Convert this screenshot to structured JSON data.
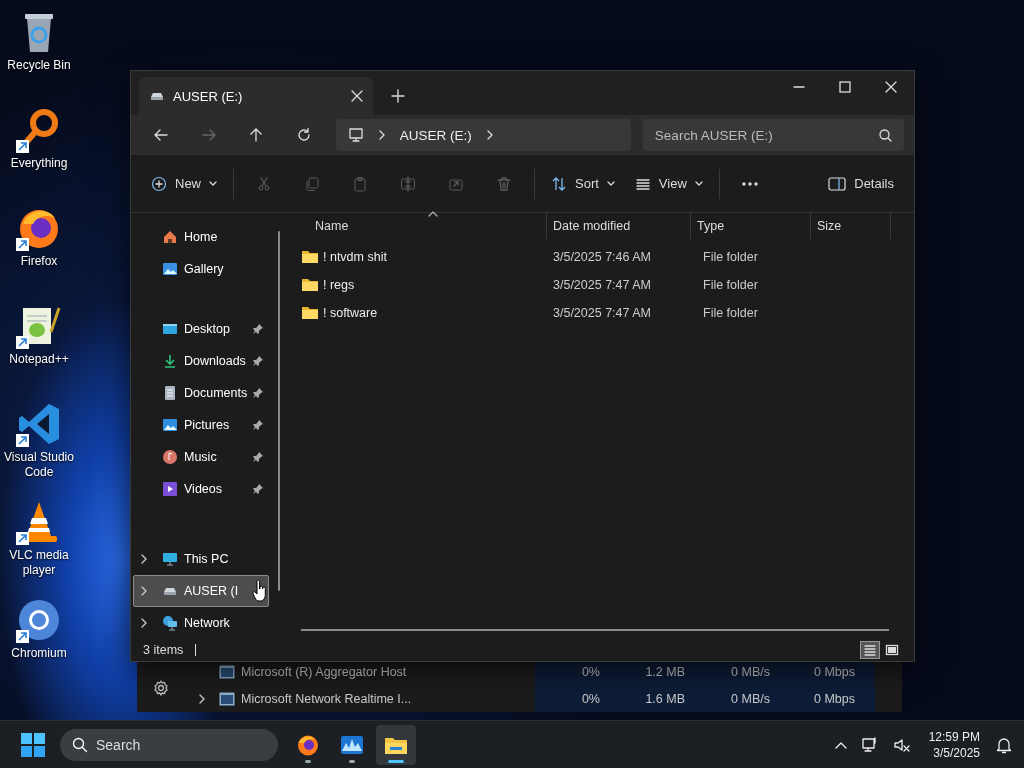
{
  "desktop_icons": [
    {
      "label": "Recycle Bin",
      "kind": "recycle-bin",
      "shortcut": false
    },
    {
      "label": "Everything",
      "kind": "everything",
      "shortcut": true
    },
    {
      "label": "Firefox",
      "kind": "firefox",
      "shortcut": true
    },
    {
      "label": "Notepad++",
      "kind": "notepad",
      "shortcut": true
    },
    {
      "label": "Visual Studio Code",
      "kind": "vscode",
      "shortcut": true
    },
    {
      "label": "VLC media player",
      "kind": "vlc",
      "shortcut": true
    },
    {
      "label": "Chromium",
      "kind": "chromium",
      "shortcut": true
    }
  ],
  "task_manager": {
    "rows": [
      {
        "name": "Microsoft (R) Aggregator Host",
        "expandable": false,
        "values": [
          "0%",
          "1.2 MB",
          "0 MB/s",
          "0 Mbps"
        ]
      },
      {
        "name": "Microsoft Network Realtime I...",
        "expandable": true,
        "values": [
          "0%",
          "1.6 MB",
          "0 MB/s",
          "0 Mbps"
        ]
      }
    ]
  },
  "explorer": {
    "tabs": [
      {
        "title": "AUSER (E:)",
        "selected": true
      }
    ],
    "breadcrumb": [
      "AUSER (E:)"
    ],
    "search": {
      "placeholder": "Search AUSER (E:)"
    },
    "toolbar": {
      "groups": [
        [
          {
            "kind": "new",
            "label": "New",
            "disabled": false
          }
        ],
        [
          {
            "kind": "cut",
            "disabled": true
          },
          {
            "kind": "copy",
            "disabled": true
          },
          {
            "kind": "paste",
            "disabled": true
          },
          {
            "kind": "rename",
            "disabled": true
          },
          {
            "kind": "share",
            "disabled": true
          },
          {
            "kind": "delete",
            "disabled": true
          }
        ],
        [
          {
            "kind": "sort",
            "label": "Sort",
            "disabled": false
          },
          {
            "kind": "view",
            "label": "View",
            "disabled": false
          }
        ],
        [
          {
            "kind": "more",
            "disabled": false
          }
        ]
      ],
      "details": {
        "label": "Details"
      }
    },
    "sidebar": {
      "groups": [
        {
          "items": [
            {
              "label": "Home",
              "kind": "home",
              "pinned": false,
              "expandable": false,
              "selected": false
            },
            {
              "label": "Gallery",
              "kind": "gallery",
              "pinned": false,
              "expandable": false,
              "selected": false
            }
          ]
        },
        {
          "items": [
            {
              "label": "Desktop",
              "kind": "desktop",
              "pinned": true,
              "expandable": false,
              "selected": false
            },
            {
              "label": "Downloads",
              "kind": "downloads",
              "pinned": true,
              "expandable": false,
              "selected": false
            },
            {
              "label": "Documents",
              "kind": "documents",
              "pinned": true,
              "expandable": false,
              "selected": false
            },
            {
              "label": "Pictures",
              "kind": "pictures",
              "pinned": true,
              "expandable": false,
              "selected": false
            },
            {
              "label": "Music",
              "kind": "music",
              "pinned": true,
              "expandable": false,
              "selected": false
            },
            {
              "label": "Videos",
              "kind": "videos",
              "pinned": true,
              "expandable": false,
              "selected": false
            }
          ]
        },
        {
          "items": [
            {
              "label": "This PC",
              "kind": "this-pc",
              "pinned": false,
              "expandable": true,
              "selected": false
            },
            {
              "label": "AUSER (I",
              "kind": "drive",
              "pinned": false,
              "expandable": true,
              "selected": true
            },
            {
              "label": "Network",
              "kind": "network",
              "pinned": false,
              "expandable": true,
              "selected": false
            }
          ]
        }
      ]
    },
    "columns": [
      "Name",
      "Date modified",
      "Type",
      "Size"
    ],
    "files": [
      {
        "name": "! ntvdm shit",
        "date_modified": "3/5/2025 7:46 AM",
        "type": "File folder"
      },
      {
        "name": "! regs",
        "date_modified": "3/5/2025 7:47 AM",
        "type": "File folder"
      },
      {
        "name": "! software",
        "date_modified": "3/5/2025 7:47 AM",
        "type": "File folder"
      }
    ],
    "status": "3 items",
    "views": [
      {
        "kind": "details",
        "selected": true
      },
      {
        "kind": "tiles",
        "selected": false
      }
    ]
  },
  "taskbar": {
    "search": {
      "placeholder": "Search"
    },
    "apps": [
      {
        "kind": "firefox",
        "running": true,
        "active": false
      },
      {
        "kind": "task-manager",
        "running": true,
        "active": false
      },
      {
        "kind": "explorer",
        "running": true,
        "active": true
      }
    ],
    "time": "12:59 PM",
    "date": "3/5/2025"
  }
}
